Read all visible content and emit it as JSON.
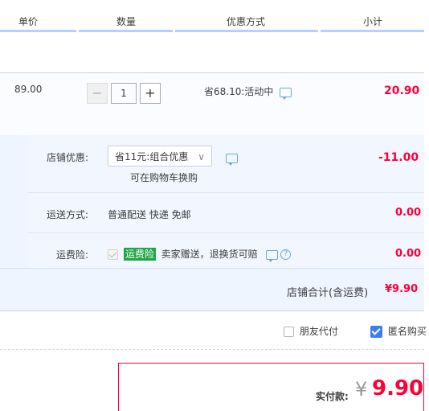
{
  "header": {
    "col_price": "单价",
    "col_qty": "数量",
    "col_discount": "优惠方式",
    "col_subtotal": "小计"
  },
  "item": {
    "unit_price": "89.00",
    "qty_minus": "−",
    "quantity": "1",
    "qty_plus": "+",
    "promo_text": "省68.10:活动中",
    "subtotal": "20.90"
  },
  "shop": {
    "discount_label": "店铺优惠:",
    "discount_selected": "省11元:组合优惠",
    "discount_hint": "可在购物车换购",
    "discount_amount": "-11.00",
    "shipping_label": "运送方式:",
    "shipping_value": "普通配送 快递 免邮",
    "shipping_amount": "0.00",
    "insurance_label": "运费险:",
    "insurance_tag": "运费险",
    "insurance_desc": "卖家赠送，退换货可赔",
    "insurance_amount": "0.00",
    "total_label": "店铺合计(含运费)",
    "total_amount": "¥9.90"
  },
  "options": {
    "friend_pay_label": "朋友代付",
    "friend_pay_checked": false,
    "anonymous_label": "匿名购买",
    "anonymous_checked": true
  },
  "payment": {
    "label": "实付款:",
    "currency": "¥",
    "amount": "9.90"
  },
  "colors": {
    "accent_red": "#ff0036",
    "header_line": "#b2d1ff",
    "panel_bg": "#eef5ff",
    "checkbox_blue": "#3c7cf0",
    "insurance_green": "#1fa544"
  }
}
